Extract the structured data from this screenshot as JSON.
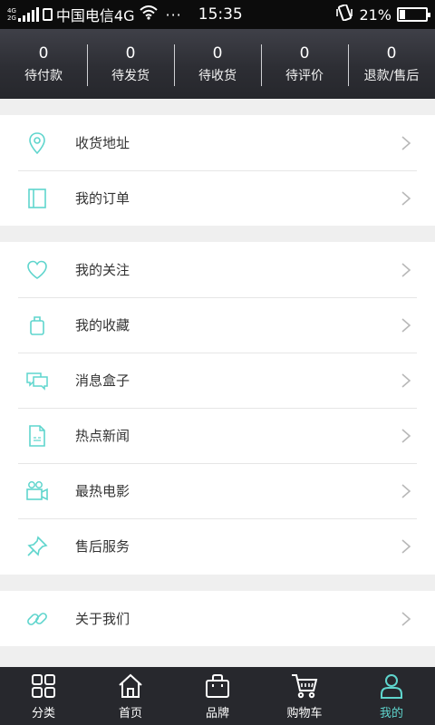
{
  "status_bar": {
    "net_top": "4G",
    "net_bottom": "2G",
    "carrier": "中国电信4G",
    "dots": "···",
    "time": "15:35",
    "battery": "21%",
    "battery_level": 0.21
  },
  "orders": [
    {
      "count": "0",
      "label": "待付款"
    },
    {
      "count": "0",
      "label": "待发货"
    },
    {
      "count": "0",
      "label": "待收货"
    },
    {
      "count": "0",
      "label": "待评价"
    },
    {
      "count": "0",
      "label": "退款/售后"
    }
  ],
  "menu": {
    "group1": [
      {
        "label": "收货地址",
        "icon": "location-pin-icon"
      },
      {
        "label": "我的订单",
        "icon": "order-book-icon"
      }
    ],
    "group2": [
      {
        "label": "我的关注",
        "icon": "heart-icon"
      },
      {
        "label": "我的收藏",
        "icon": "bag-icon"
      },
      {
        "label": "消息盒子",
        "icon": "message-icon"
      },
      {
        "label": "热点新闻",
        "icon": "news-document-icon"
      },
      {
        "label": "最热电影",
        "icon": "movie-camera-icon"
      },
      {
        "label": "售后服务",
        "icon": "pin-icon"
      }
    ],
    "group3": [
      {
        "label": "关于我们",
        "icon": "link-icon"
      }
    ]
  },
  "tabs": [
    {
      "label": "分类",
      "icon": "grid-icon",
      "active": false
    },
    {
      "label": "首页",
      "icon": "home-icon",
      "active": false
    },
    {
      "label": "品牌",
      "icon": "shopping-bag-icon",
      "active": false
    },
    {
      "label": "购物车",
      "icon": "cart-icon",
      "active": false
    },
    {
      "label": "我的",
      "icon": "user-icon",
      "active": true
    }
  ],
  "colors": {
    "accent": "#5fd5cd",
    "header_bg": "#2d2e34",
    "tabbar_bg": "#27282d",
    "page_bg": "#efefef"
  }
}
